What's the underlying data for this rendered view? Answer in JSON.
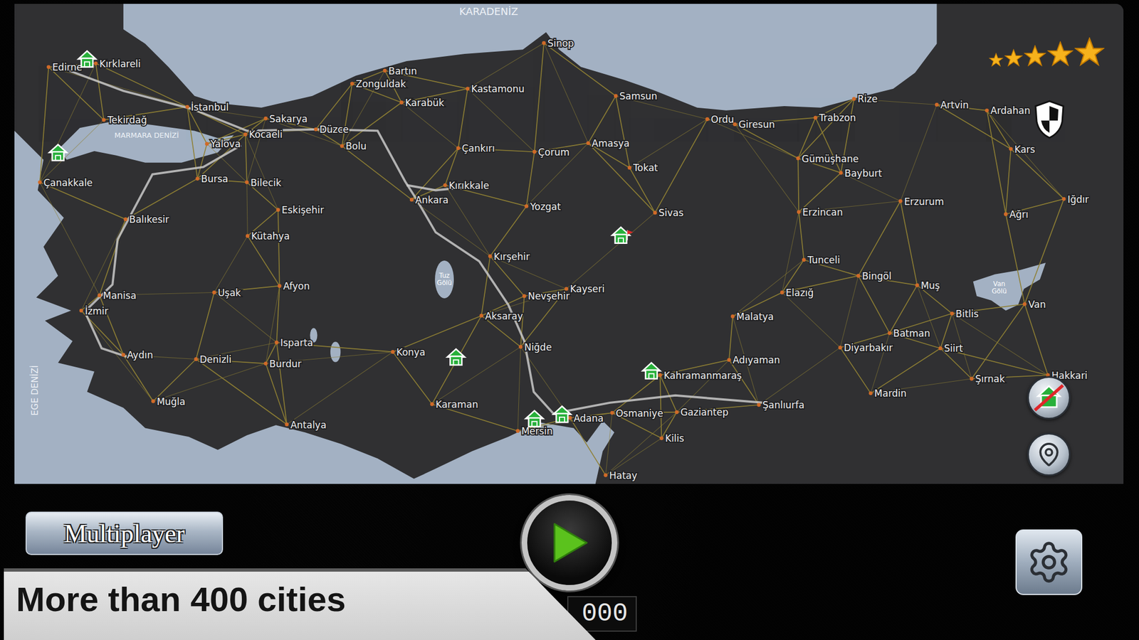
{
  "map": {
    "sea_labels": [
      "KARADENİZ",
      "MARMARA DENİZİ",
      "EGE DENİZİ"
    ],
    "lake_labels": [
      {
        "lines": [
          "Tuz",
          "Gölü"
        ]
      },
      {
        "lines": [
          "Van",
          "Gölü"
        ]
      }
    ],
    "cities": [
      "Edirne",
      "Kırklareli",
      "Tekirdağ",
      "İstanbul",
      "Sakarya",
      "Kocaeli",
      "Yalova",
      "Düzce",
      "Bolu",
      "Çanakkale",
      "Bursa",
      "Bilecik",
      "Bartın",
      "Zonguldak",
      "Karabük",
      "Kastamonu",
      "Sinop",
      "Samsun",
      "Çankırı",
      "Çorum",
      "Amasya",
      "Tokat",
      "Ordu",
      "Giresun",
      "Trabzon",
      "Rize",
      "Artvin",
      "Ardahan",
      "Kars",
      "Gümüşhane",
      "Bayburt",
      "Erzincan",
      "Erzurum",
      "Ağrı",
      "Iğdır",
      "Kırıkkale",
      "Ankara",
      "Eskişehir",
      "Yozgat",
      "Sivas",
      "Balıkesir",
      "Kütahya",
      "Kırşehir",
      "Tunceli",
      "Bingöl",
      "Muş",
      "Elazığ",
      "Malatya",
      "Van",
      "Bitlis",
      "Manisa",
      "Uşak",
      "Afyon",
      "Kayseri",
      "Nevşehir",
      "Aksaray",
      "İzmir",
      "Isparta",
      "Niğde",
      "Konya",
      "Denizli",
      "Burdur",
      "Aydın",
      "Batman",
      "Siirt",
      "Diyarbakır",
      "Adıyaman",
      "Kahramanmaraş",
      "Şırnak",
      "Hakkari",
      "Mardin",
      "Şanlıurfa",
      "Gaziantep",
      "Osmaniye",
      "Adana",
      "Karaman",
      "Muğla",
      "Antalya",
      "Mersin",
      "Kilis",
      "Hatay"
    ],
    "garages": [
      {
        "flagged": false
      },
      {
        "flagged": false
      },
      {
        "flagged": true
      },
      {
        "flagged": false
      },
      {
        "flagged": false
      },
      {
        "flagged": false
      },
      {
        "flagged": false
      }
    ]
  },
  "rating": {
    "stars": 5
  },
  "multiplayer_button": "Multiplayer",
  "counter": "000",
  "banner": "More than 400 cities"
}
